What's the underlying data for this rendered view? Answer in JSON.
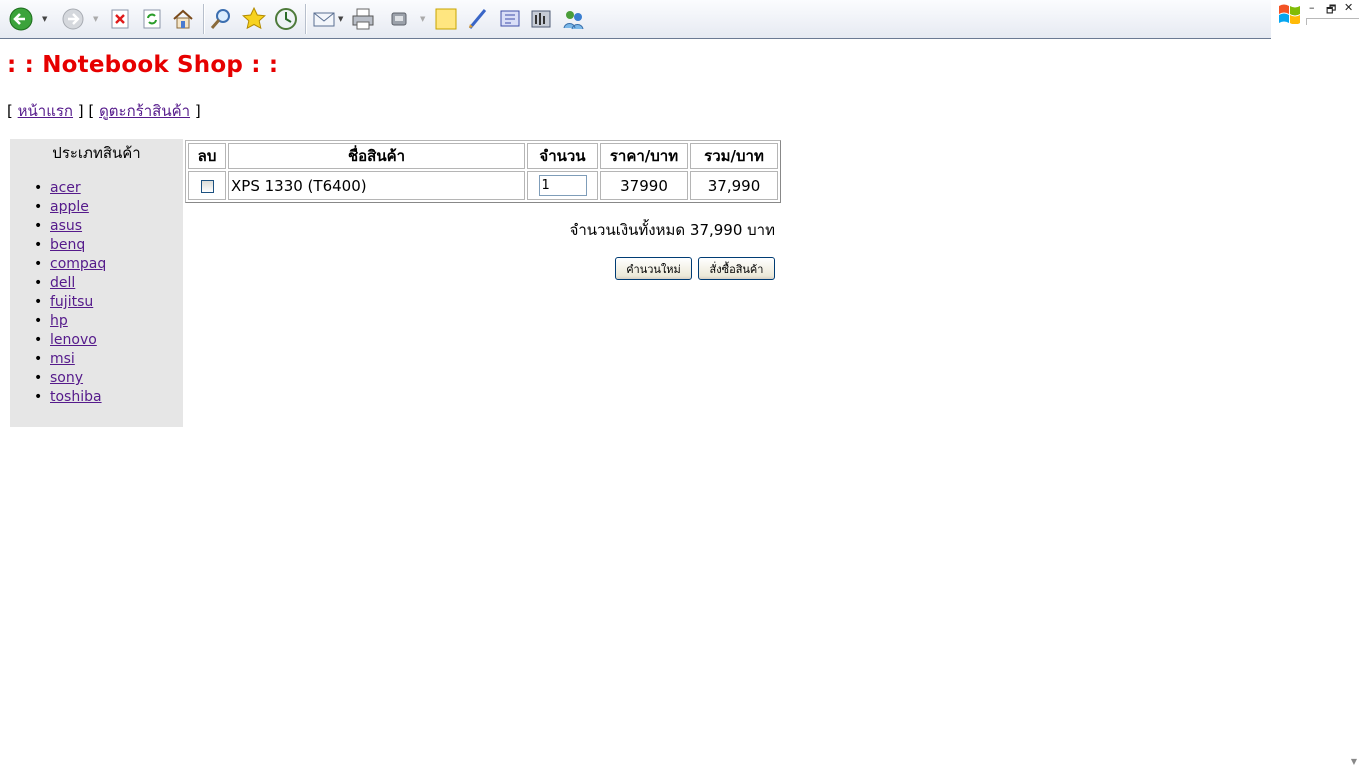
{
  "page": {
    "title": ": : Notebook Shop : :",
    "nav": {
      "open": "[",
      "home": "หน้าแรก",
      "mid": "] [",
      "cart": "ดูตะกร้าสินค้า",
      "close": "]"
    }
  },
  "sidebar": {
    "heading": "ประเภทสินค้า",
    "brands": [
      "acer",
      "apple",
      "asus",
      "benq",
      "compaq",
      "dell",
      "fujitsu",
      "hp",
      "lenovo",
      "msi",
      "sony",
      "toshiba"
    ]
  },
  "cart": {
    "headers": {
      "delete": "ลบ",
      "name": "ชื่อสินค้า",
      "qty": "จำนวน",
      "price": "ราคา/บาท",
      "total": "รวม/บาท"
    },
    "rows": [
      {
        "name": "XPS 1330 (T6400)",
        "qty": "1",
        "price": "37990",
        "total": "37,990"
      }
    ],
    "grand_total": "จำนวนเงินทั้งหมด 37,990 บาท",
    "recalc_label": "คำนวนใหม่",
    "order_label": "สั่งซื้อสินค้า"
  },
  "colors": {
    "title": "#e60000",
    "link": "#551a8b",
    "sidebar_bg": "#e6e6e6"
  },
  "toolbar": {
    "icons": [
      "back-icon",
      "forward-icon",
      "stop-icon",
      "refresh-icon",
      "home-icon",
      "search-icon",
      "favorites-icon",
      "history-icon",
      "mail-icon",
      "print-icon",
      "edit-icon",
      "notes-icon",
      "discuss-icon",
      "research-icon",
      "media-icon",
      "messenger-icon"
    ]
  }
}
